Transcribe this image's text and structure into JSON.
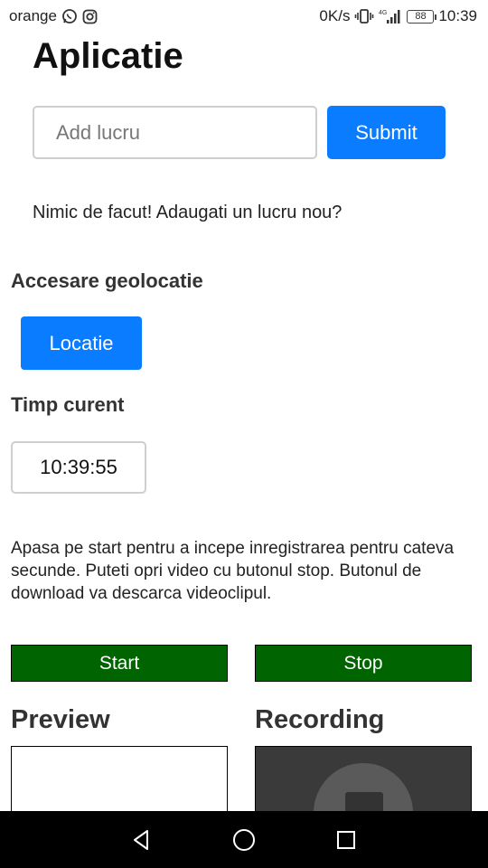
{
  "status_bar": {
    "carrier": "orange",
    "speed": "0K/s",
    "network": "4G",
    "battery": "88",
    "time": "10:39"
  },
  "app": {
    "title": "Aplicatie"
  },
  "todo": {
    "input_placeholder": "Add lucru",
    "input_value": "",
    "submit_label": "Submit",
    "empty_message": "Nimic de facut! Adaugati un lucru nou?"
  },
  "geolocation": {
    "heading": "Accesare geolocatie",
    "button_label": "Locatie"
  },
  "clock": {
    "heading": "Timp curent",
    "value": "10:39:55"
  },
  "recorder": {
    "instructions": "Apasa pe start pentru a incepe inregistrarea pentru cateva secunde. Puteti opri video cu butonul stop. Butonul de download va descarca videoclipul.",
    "start_label": "Start",
    "stop_label": "Stop",
    "preview_heading": "Preview",
    "recording_heading": "Recording"
  },
  "colors": {
    "primary": "#0a7cff",
    "record_button": "#006400",
    "nav_bar": "#000000"
  },
  "icons": {
    "status_left": [
      "whatsapp-icon",
      "instagram-icon"
    ],
    "status_right": [
      "vibrate-icon",
      "signal-icon",
      "battery-icon"
    ],
    "nav": [
      "back-icon",
      "home-icon",
      "recents-icon"
    ],
    "recording": "video-placeholder-icon"
  }
}
